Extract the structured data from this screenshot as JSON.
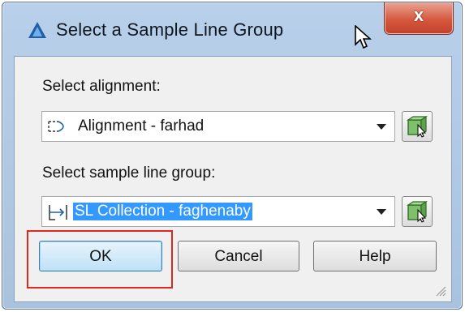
{
  "window": {
    "title": "Select a Sample Line Group",
    "close_glyph": "x"
  },
  "alignment": {
    "label": "Select alignment:",
    "value": "Alignment - farhad",
    "icon": "alignment-icon"
  },
  "sample_line_group": {
    "label": "Select sample line group:",
    "value": "SL Collection - faghenaby",
    "icon": "sample-line-icon"
  },
  "buttons": {
    "ok": "OK",
    "cancel": "Cancel",
    "help": "Help"
  },
  "colors": {
    "title_bar": "#b8d0ea",
    "close_button": "#d5583e",
    "selection": "#3399ff",
    "highlight_box": "#e0281e"
  }
}
